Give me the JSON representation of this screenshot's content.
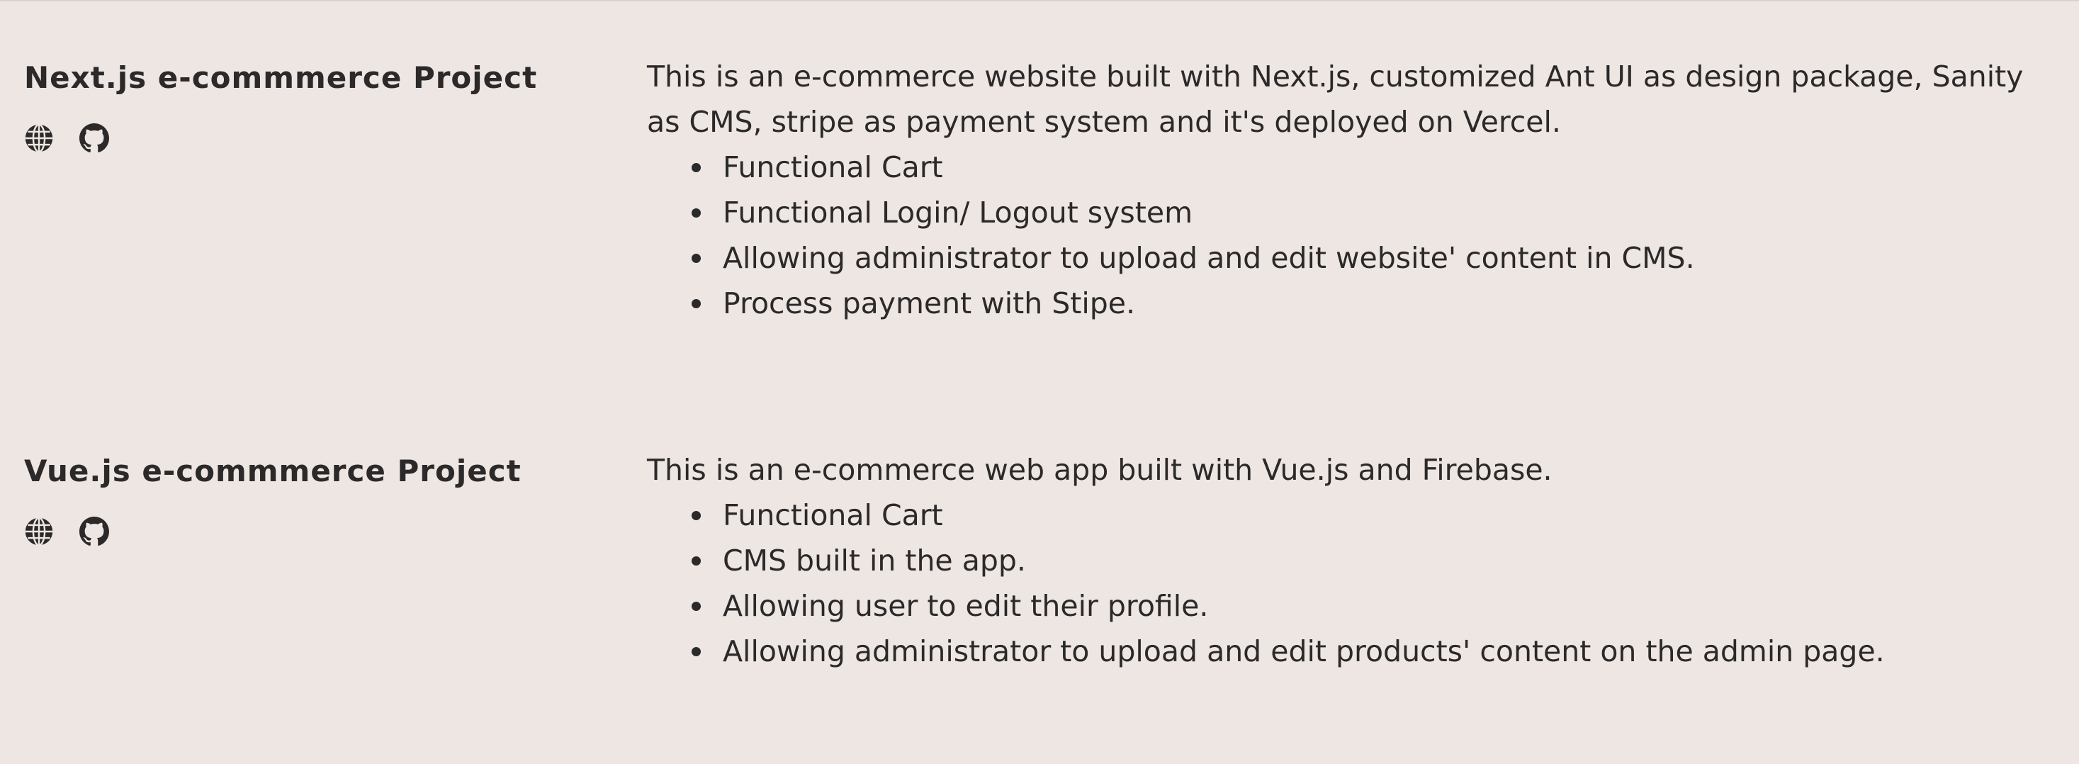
{
  "projects": [
    {
      "title": "Next.js e-commmerce Project",
      "links": [
        {
          "icon": "globe-icon"
        },
        {
          "icon": "github-icon"
        }
      ],
      "description": "This is an e-commerce website built with Next.js, customized Ant UI as design package, Sanity as CMS, stripe as payment system and it's deployed on Vercel.",
      "features": [
        "Functional Cart",
        "Functional Login/ Logout system",
        "Allowing administrator to upload and edit website' content in CMS.",
        "Process payment with Stipe."
      ]
    },
    {
      "title": "Vue.js e-commmerce Project",
      "links": [
        {
          "icon": "globe-icon"
        },
        {
          "icon": "github-icon"
        }
      ],
      "description": "This is an e-commerce web app built with Vue.js and Firebase.",
      "features": [
        "Functional Cart",
        "CMS built in the app.",
        "Allowing user to edit their profile.",
        "Allowing administrator to upload and edit products' content on the admin page."
      ]
    }
  ],
  "colors": {
    "background": "#ede6e2",
    "text": "#2b2929"
  }
}
